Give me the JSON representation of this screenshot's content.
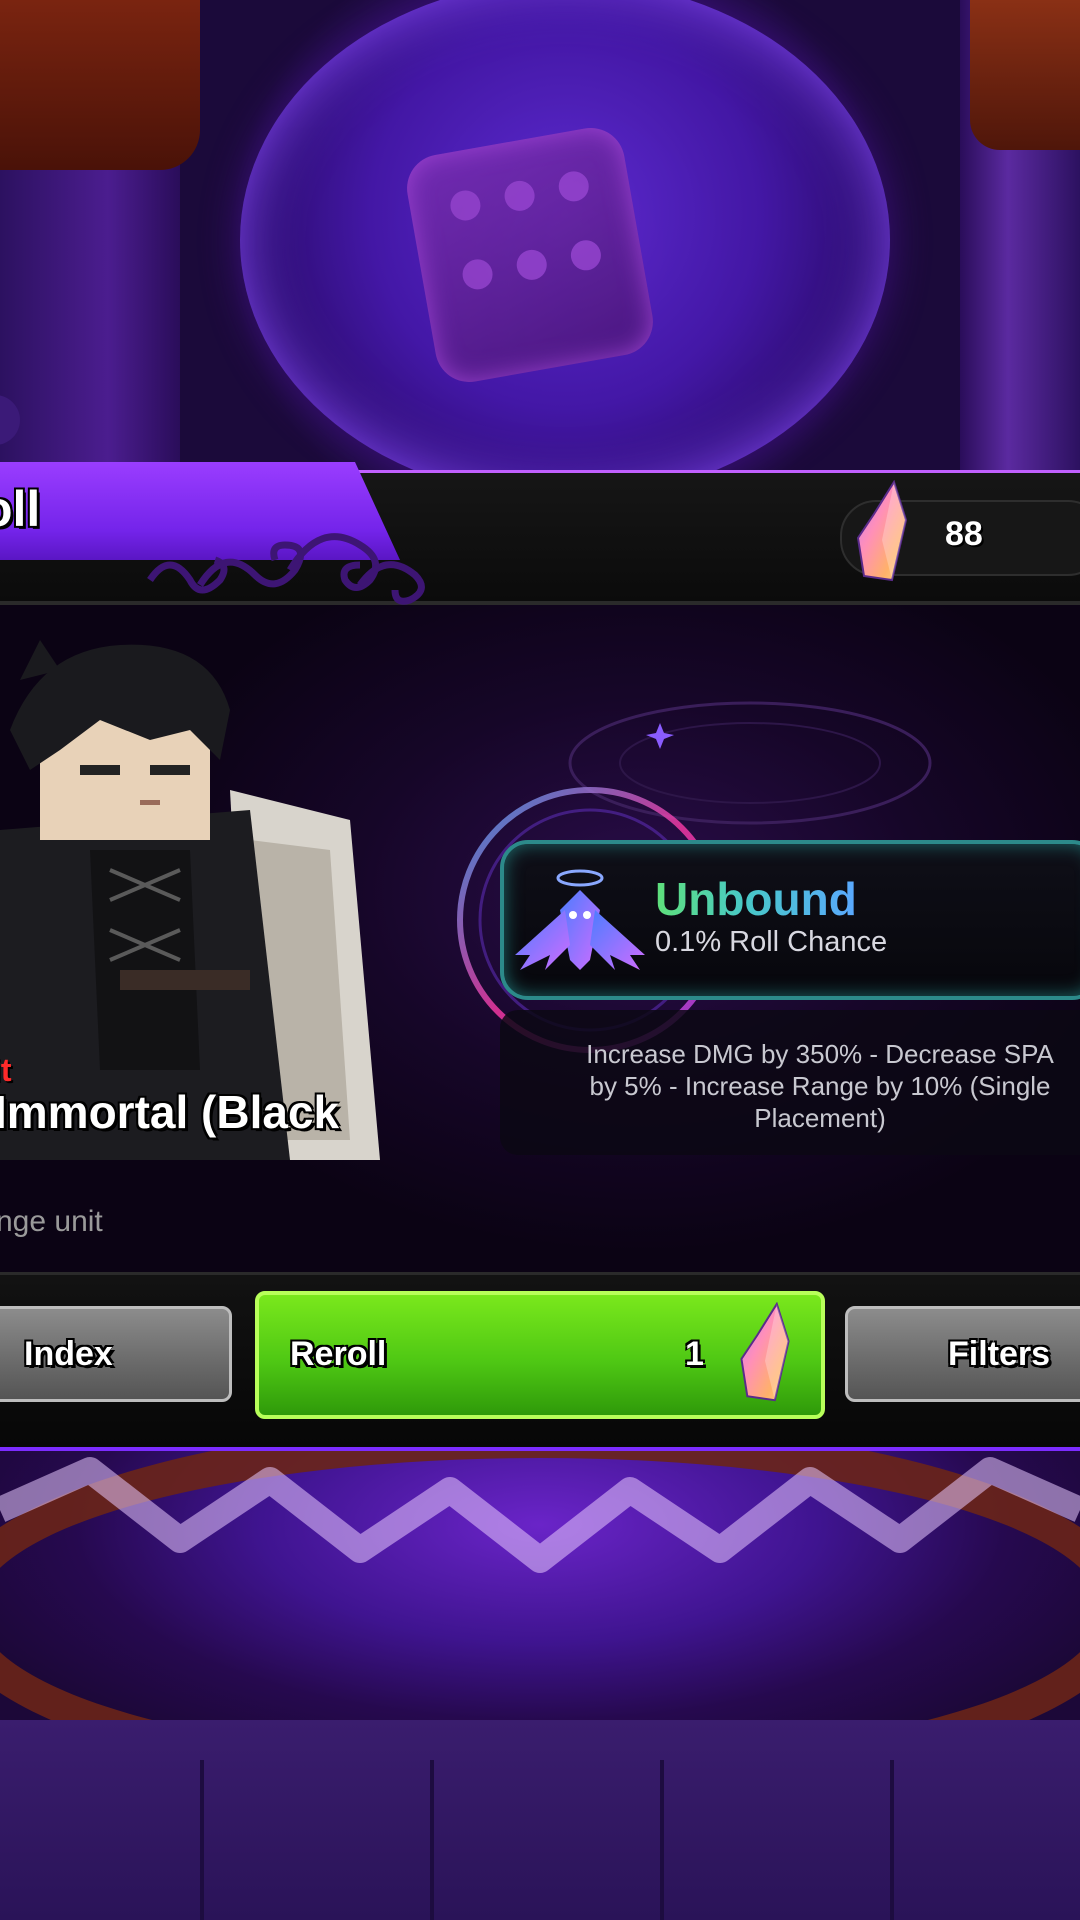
{
  "header": {
    "title": "oll"
  },
  "currency": {
    "amount": "88",
    "icon": "crystal-icon"
  },
  "unit": {
    "rarity": "it",
    "name": "Immortal (Black",
    "type": "nge unit"
  },
  "trait": {
    "name": "Unbound",
    "chance": "0.1% Roll Chance",
    "icon": "winged-crest-icon",
    "description": "Increase DMG by 350% - Decrease SPA\nby 5% - Increase Range by 10% (Single\nPlacement)"
  },
  "buttons": {
    "index": "Index",
    "reroll": "Reroll",
    "reroll_cost": "1",
    "filters": "Filters"
  },
  "colors": {
    "accent": "#9a3dff",
    "reroll_green": "#4fc814",
    "rarity_red": "#ff2a2a"
  }
}
